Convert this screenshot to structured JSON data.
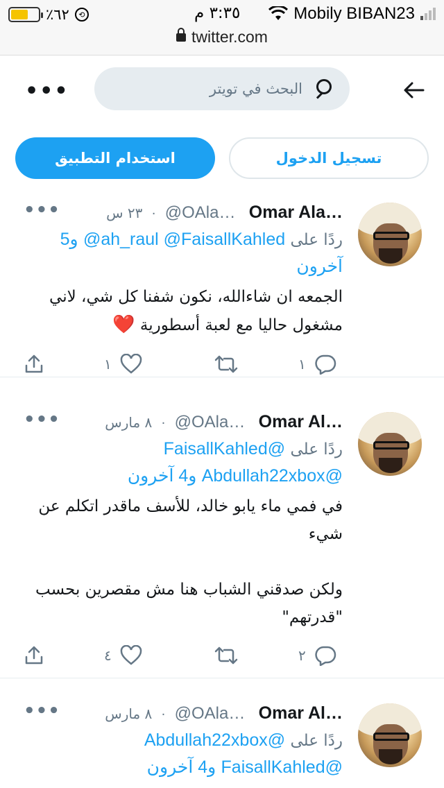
{
  "status_bar": {
    "battery_percent": "٪٦٢",
    "battery_level": 0.62,
    "time": "٣:٣٥ م",
    "carrier": "Mobily BIBAN23",
    "url": "twitter.com"
  },
  "header": {
    "search_placeholder": "البحث في تويتر",
    "more_label": "•••"
  },
  "auth": {
    "use_app_label": "استخدام التطبيق",
    "login_label": "تسجيل الدخول"
  },
  "colors": {
    "accent": "#1da1f2",
    "heart": "#e0245e",
    "muted": "#657786"
  },
  "tweets": [
    {
      "name": "Omar Ala…",
      "handle": "@OAla…",
      "time": "٢٣ س",
      "reply_prefix": "ردًا على",
      "mentions": "@ah_raul @FaisallKahled",
      "others": "و5 آخرون",
      "text_line1": "الجمعه ان شاءالله،  نكون شفنا كل شي، لاني",
      "text_line2": "مشغول حاليا مع لعبة أسطورية",
      "emoji": "❤️",
      "replies": "١",
      "likes": "١",
      "more": "•••"
    },
    {
      "name": "Omar Al…",
      "handle": "@OAla…",
      "time": "٨ مارس",
      "reply_prefix": "ردًا على",
      "mention1": "@FaisallKahled",
      "mention2": "@Abdullah22xbox",
      "others": "و4 آخرون",
      "text": "في فمي ماء يابو خالد، للأسف ماقدر اتكلم عن\nشيء\n\nولكن صدقني الشباب هنا مش مقصرين بحسب\n\"قدرتهم\"",
      "replies": "٢",
      "likes": "٤",
      "more": "•••"
    },
    {
      "name": "Omar Al…",
      "handle": "@OAla…",
      "time": "٨ مارس",
      "reply_prefix": "ردًا على",
      "mention1": "@Abdullah22xbox",
      "mention2": "@FaisallKahled",
      "others": "و4 آخرون",
      "more": "•••"
    }
  ]
}
